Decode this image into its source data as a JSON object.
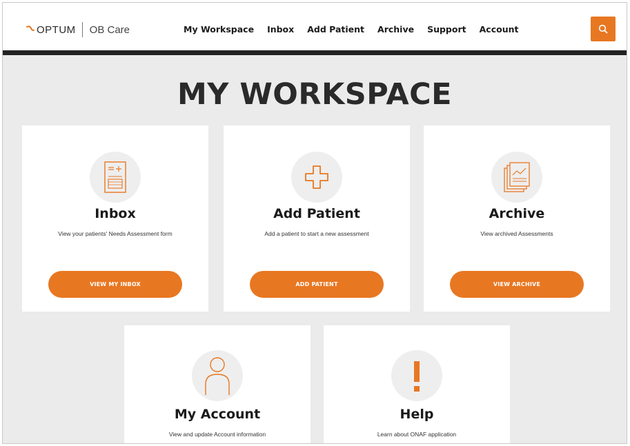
{
  "header": {
    "brand": "OPTUM",
    "product": "OB Care",
    "nav": [
      "My Workspace",
      "Inbox",
      "Add Patient",
      "Archive",
      "Support",
      "Account"
    ],
    "search_icon": "search-icon"
  },
  "page": {
    "title": "MY WORKSPACE"
  },
  "cards": [
    {
      "title": "Inbox",
      "description": "View your patients' Needs Assessment form",
      "button": "VIEW MY INBOX",
      "icon": "inbox-form-icon"
    },
    {
      "title": "Add Patient",
      "description": "Add a patient to start a new assessment",
      "button": "ADD PATIENT",
      "icon": "plus-icon"
    },
    {
      "title": "Archive",
      "description": "View archived Assessments",
      "button": "VIEW ARCHIVE",
      "icon": "archive-docs-icon"
    },
    {
      "title": "My Account",
      "description": "View and update Account information",
      "icon": "user-icon"
    },
    {
      "title": "Help",
      "description": "Learn about ONAF application",
      "icon": "exclamation-icon"
    }
  ],
  "colors": {
    "accent": "#e87722",
    "header_bar": "#222222",
    "background": "#ebebeb"
  }
}
